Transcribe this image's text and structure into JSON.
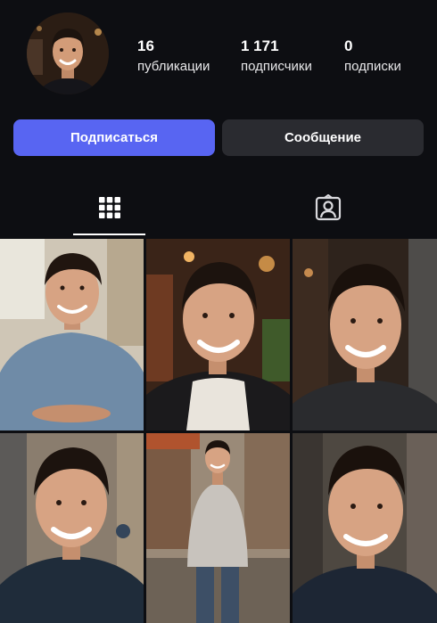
{
  "profile": {
    "stats": {
      "posts_count": "16",
      "posts_label": "публикации",
      "followers_count": "1 171",
      "followers_label": "подписчики",
      "following_count": "0",
      "following_label": "подписки"
    },
    "actions": {
      "follow_label": "Подписаться",
      "message_label": "Сообщение"
    }
  },
  "tabs": [
    {
      "name": "grid",
      "icon": "grid-icon",
      "active": true
    },
    {
      "name": "tagged",
      "icon": "tagged-person-icon",
      "active": false
    }
  ],
  "colors": {
    "background": "#0d0e12",
    "follow_button": "#5865f2",
    "message_button": "#2a2b30",
    "text": "#ffffff"
  },
  "posts": [
    {
      "description": "photo",
      "index": 1
    },
    {
      "description": "photo",
      "index": 2
    },
    {
      "description": "photo",
      "index": 3
    },
    {
      "description": "photo",
      "index": 4
    },
    {
      "description": "photo",
      "index": 5
    },
    {
      "description": "photo",
      "index": 6
    }
  ]
}
